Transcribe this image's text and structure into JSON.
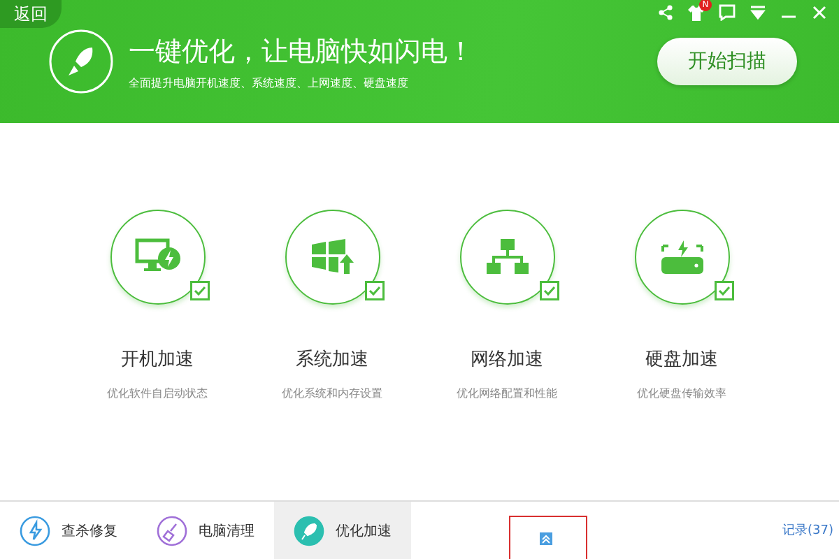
{
  "header": {
    "back": "返回",
    "title": "一键优化，让电脑快如闪电！",
    "subtitle": "全面提升电脑开机速度、系统速度、上网速度、硬盘速度",
    "scan_button": "开始扫描",
    "notification_badge": "N"
  },
  "items": [
    {
      "kind": "boot",
      "title": "开机加速",
      "desc": "优化软件自启动状态",
      "checked": true
    },
    {
      "kind": "system",
      "title": "系统加速",
      "desc": "优化系统和内存设置",
      "checked": true
    },
    {
      "kind": "network",
      "title": "网络加速",
      "desc": "优化网络配置和性能",
      "checked": true
    },
    {
      "kind": "disk",
      "title": "硬盘加速",
      "desc": "优化硬盘传输效率",
      "checked": true
    }
  ],
  "footer": {
    "tabs": [
      {
        "kind": "scan",
        "label": "查杀修复",
        "color": "#3a9be0",
        "selected": false
      },
      {
        "kind": "clean",
        "label": "电脑清理",
        "color": "#a070d8",
        "selected": false
      },
      {
        "kind": "speed",
        "label": "优化加速",
        "color": "#2bbfb0",
        "selected": true
      }
    ],
    "history": "记录(37)"
  }
}
